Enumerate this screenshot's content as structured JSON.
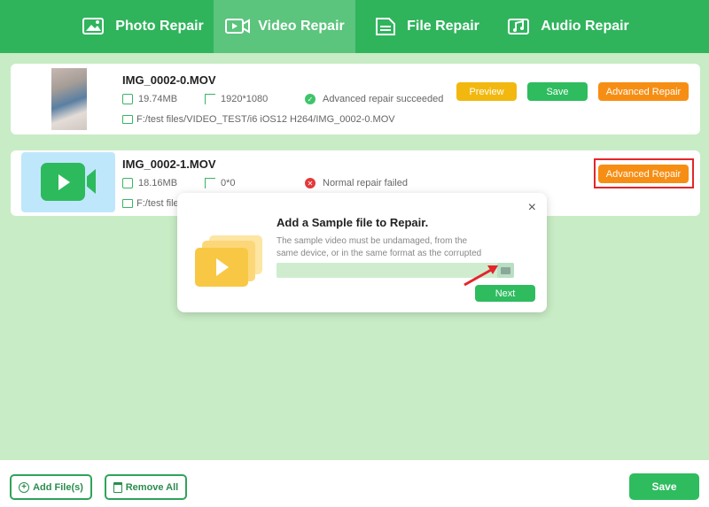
{
  "tabs": [
    {
      "label": "Photo Repair",
      "icon": "photo-icon"
    },
    {
      "label": "Video Repair",
      "icon": "video-icon"
    },
    {
      "label": "File Repair",
      "icon": "file-icon"
    },
    {
      "label": "Audio Repair",
      "icon": "audio-icon"
    }
  ],
  "files": [
    {
      "name": "IMG_0002-0.MOV",
      "size": "19.74MB",
      "resolution": "1920*1080",
      "status": "Advanced repair succeeded",
      "path": "F:/test files/VIDEO_TEST/i6 iOS12 H264/IMG_0002-0.MOV",
      "buttons": {
        "preview": "Preview",
        "save": "Save",
        "advanced": "Advanced Repair"
      }
    },
    {
      "name": "IMG_0002-1.MOV",
      "size": "18.16MB",
      "resolution": "0*0",
      "status": "Normal repair failed",
      "path": "F:/test files",
      "buttons": {
        "advanced": "Advanced Repair"
      }
    }
  ],
  "modal": {
    "title": "Add a Sample file to Repair.",
    "description": "The sample video must be undamaged, from the same device, or in the same format as the corrupted one.",
    "field_value": "",
    "next_label": "Next",
    "close_glyph": "×"
  },
  "bottom": {
    "add_label": "Add File(s)",
    "remove_label": "Remove All",
    "save_label": "Save"
  },
  "colors": {
    "brand_green": "#2fb45c",
    "orange": "#f78e14",
    "yellow": "#f2b80f",
    "highlight_red": "#e3262a"
  }
}
